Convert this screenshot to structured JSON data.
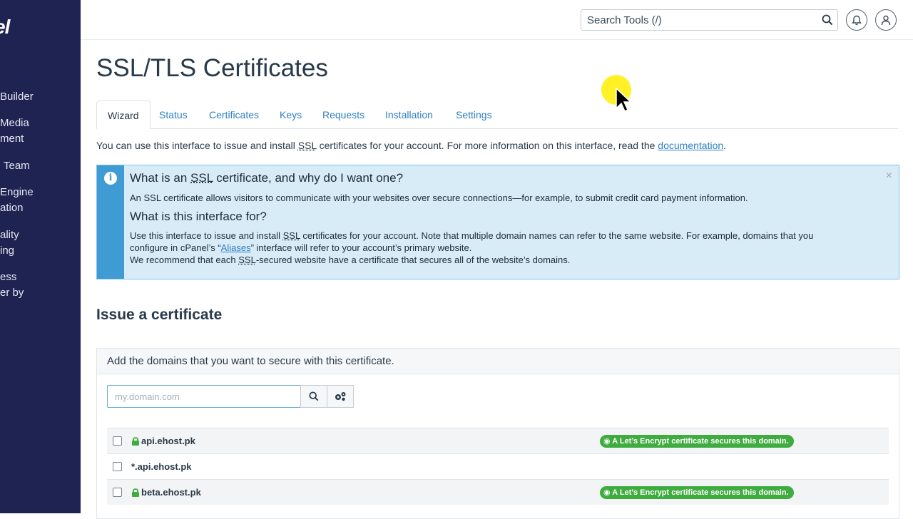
{
  "sidebar": {
    "logo": "el",
    "items": [
      {
        "lines": [
          "Builder"
        ]
      },
      {
        "lines": [
          "Media",
          "ment"
        ]
      },
      {
        "lines": [
          "Team"
        ]
      },
      {
        "lines": [
          "Engine",
          "ation"
        ]
      },
      {
        "lines": [
          "ality",
          "ing"
        ]
      },
      {
        "lines": [
          "ess",
          "er by"
        ]
      }
    ]
  },
  "topbar": {
    "search_placeholder": "Search Tools (/)"
  },
  "page": {
    "title": "SSL/TLS Certificates",
    "tabs": [
      "Wizard",
      "Status",
      "Certificates",
      "Keys",
      "Requests",
      "Installation",
      "Settings"
    ],
    "intro_before_ssl": "You can use this interface to issue and install ",
    "intro_ssl": "SSL",
    "intro_after_ssl": " certificates for your account. For more information on this interface, read the ",
    "intro_link": "documentation",
    "intro_end": "."
  },
  "alert": {
    "heading1_a": "What is an ",
    "heading1_ssl": "SSL",
    "heading1_b": " certificate, and why do I want one?",
    "text1": "An SSL certificate allows visitors to communicate with your websites over secure connections—for example, to submit credit card payment information.",
    "heading2": "What is this interface for?",
    "text2_a": "Use this interface to issue and install ",
    "text2_ssl": "SSL",
    "text2_b": " certificates for your account. Note that multiple domain names can refer to the same website. For example, domains that you",
    "text3_a": "configure in cPanel’s “",
    "text3_link": "Aliases",
    "text3_b": "” interface will refer to your account’s primary website.",
    "text4_a": "We recommend that each ",
    "text4_ssl": "SSL",
    "text4_b": "-secured website have a certificate that secures all of the website’s domains.",
    "close": "×"
  },
  "issue": {
    "title": "Issue a certificate",
    "panel_heading": "Add the domains that you want to secure with this certificate.",
    "domain_placeholder": "my.domain.com",
    "domains": [
      {
        "name": "api.ehost.pk",
        "secured": true,
        "badge": "A Let’s Encrypt certificate secures this domain."
      },
      {
        "name": "*.api.ehost.pk",
        "secured": false,
        "badge": ""
      },
      {
        "name": "beta.ehost.pk",
        "secured": true,
        "badge": "A Let’s Encrypt certificate secures this domain."
      }
    ]
  },
  "colors": {
    "sidebar": "#1e2352",
    "link": "#2f7fc1",
    "alert_bg": "#d8ecf8",
    "alert_bar": "#3e9bd3",
    "badge": "#3fac3f",
    "cursor_highlight": "#ffee00"
  }
}
